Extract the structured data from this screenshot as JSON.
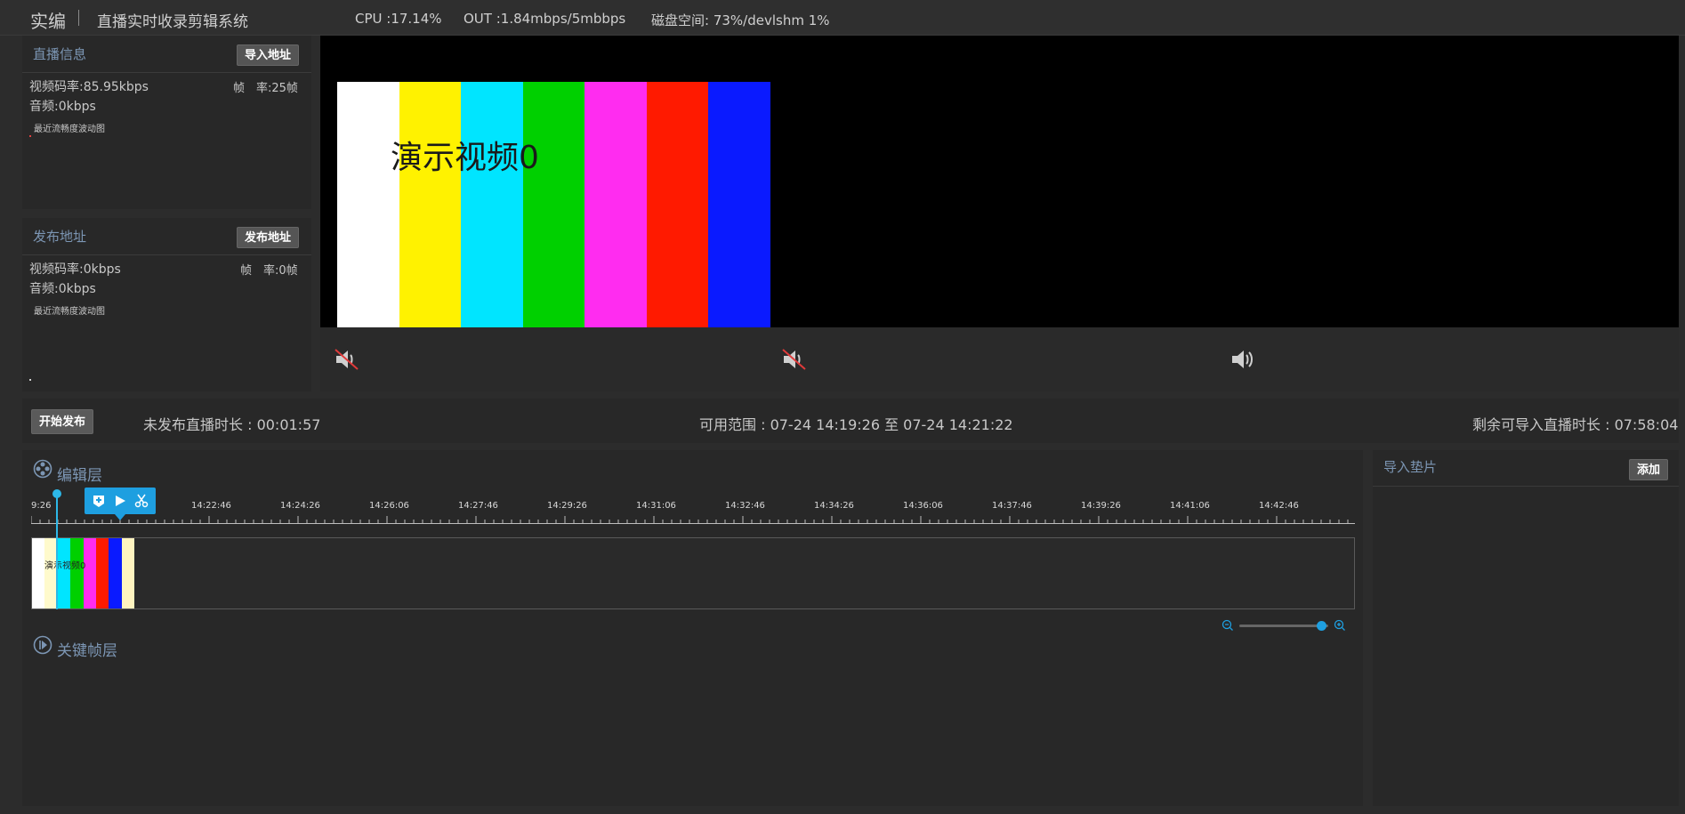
{
  "header": {
    "brand": "实编",
    "system_title": "直播实时收录剪辑系统",
    "cpu": "CPU :17.14%",
    "out": "OUT :1.84mbps/5mbbps",
    "disk": "磁盘空间: 73%/devlshm 1%"
  },
  "live_info": {
    "title": "直播信息",
    "import_button": "导入地址",
    "video_bitrate": "视频码率:85.95kbps",
    "frame_rate": "帧　率:25帧",
    "audio": "音频:0kbps",
    "chart_label": "最近流畅度波动图"
  },
  "publish_info": {
    "title": "发布地址",
    "publish_button": "发布地址",
    "video_bitrate": "视频码率:0kbps",
    "frame_rate": "帧　率:0帧",
    "audio": "音频:0kbps",
    "chart_label": "最近流畅度波动图"
  },
  "video": {
    "demo_label": "演示视频0",
    "bar_colors": [
      "#ffffff",
      "#fff200",
      "#00e5ff",
      "#00d000",
      "#ff2cf0",
      "#ff1a00",
      "#0a1aff"
    ]
  },
  "control": {
    "start_button": "开始发布",
    "unpublished_duration": "未发布直播时长 : 00:01:57",
    "available_range": "可用范围 : 07-24 14:19:26 至 07-24 14:21:22",
    "remaining_duration": "剩余可导入直播时长 : 07:58:04"
  },
  "edit_layer": {
    "title": "编辑层",
    "ruler_labels": [
      "9:26",
      "14:22:46",
      "14:24:26",
      "14:26:06",
      "14:27:46",
      "14:29:26",
      "14:31:06",
      "14:32:46",
      "14:34:26",
      "14:36:06",
      "14:37:46",
      "14:39:26",
      "14:41:06",
      "14:42:46"
    ],
    "clip_label": "演示视频0"
  },
  "keyframe_layer": {
    "title": "关键帧层"
  },
  "pad": {
    "title": "导入垫片",
    "add_button": "添加"
  }
}
